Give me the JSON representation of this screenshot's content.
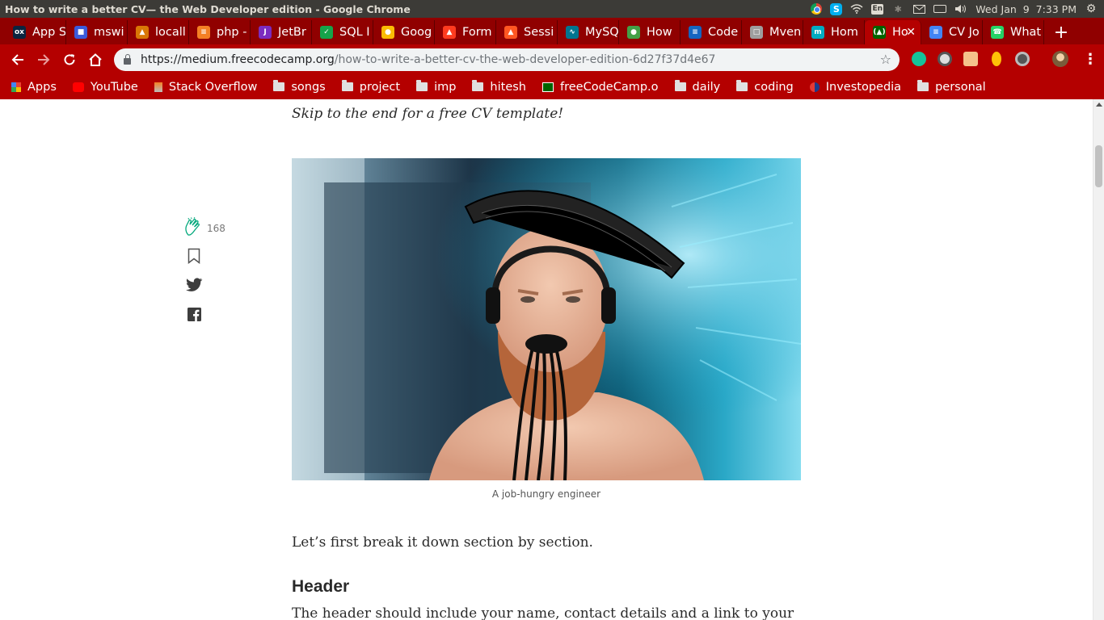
{
  "os": {
    "window_title": "How to write a better CV— the Web Developer edition - Google Chrome",
    "keyboard_layout": "En",
    "clock": "Wed Jan  9  7:33 PM"
  },
  "tabs": [
    {
      "label": "App S",
      "color": "#0a2540",
      "glyph": "ox"
    },
    {
      "label": "mswi",
      "color": "#3b5bdb",
      "glyph": "■"
    },
    {
      "label": "locall",
      "color": "#d97706",
      "glyph": "▲"
    },
    {
      "label": "php -",
      "color": "#f48024",
      "glyph": "≡"
    },
    {
      "label": "JetBr",
      "color": "#7b2cbf",
      "glyph": "J"
    },
    {
      "label": "SQL I",
      "color": "#16a34a",
      "glyph": "✓"
    },
    {
      "label": "Goog",
      "color": "#fbbc04",
      "glyph": "●"
    },
    {
      "label": "Form",
      "color": "#ff3b1f",
      "glyph": "▲"
    },
    {
      "label": "Sessi",
      "color": "#ff5722",
      "glyph": "▲"
    },
    {
      "label": "MySQ",
      "color": "#00758f",
      "glyph": "∿"
    },
    {
      "label": "How",
      "color": "#43a047",
      "glyph": "●"
    },
    {
      "label": "Code",
      "color": "#1565c0",
      "glyph": "≡"
    },
    {
      "label": "Mven",
      "color": "#9e9e9e",
      "glyph": "□"
    },
    {
      "label": "Hom",
      "color": "#00acc1",
      "glyph": "m"
    },
    {
      "label": "Ho",
      "color": "#006400",
      "glyph": "(▲)",
      "active": true
    },
    {
      "label": "CV Jo",
      "color": "#4285f4",
      "glyph": "≡"
    },
    {
      "label": "What",
      "color": "#25d366",
      "glyph": "☎"
    }
  ],
  "toolbar": {
    "url_host": "https://medium.freecodecamp.org",
    "url_path": "/how-to-write-a-better-cv-the-web-developer-edition-6d27f37d4e67",
    "extensions": [
      "grammarly-icon",
      "blocker-icon",
      "extension-icon",
      "bulb-icon",
      "circle-icon"
    ]
  },
  "bookmarks": [
    {
      "label": "Apps",
      "type": "apps"
    },
    {
      "label": "YouTube",
      "type": "youtube"
    },
    {
      "label": "Stack Overflow",
      "type": "stackoverflow"
    },
    {
      "label": "songs",
      "type": "folder"
    },
    {
      "label": "project",
      "type": "folder"
    },
    {
      "label": "imp",
      "type": "folder"
    },
    {
      "label": "hitesh",
      "type": "folder"
    },
    {
      "label": "freeCodeCamp.o",
      "type": "freecodecamp"
    },
    {
      "label": "daily",
      "type": "folder"
    },
    {
      "label": "coding",
      "type": "folder"
    },
    {
      "label": "Investopedia",
      "type": "investopedia"
    },
    {
      "label": "personal",
      "type": "folder"
    }
  ],
  "article": {
    "intro_italic": "Skip to the end for a free CV template!",
    "image_caption": "A job-hungry engineer",
    "paragraph_1": "Let’s first break it down section by section.",
    "heading_header": "Header",
    "paragraph_2": "The header should include your name, contact details and a link to your"
  },
  "share": {
    "claps": "168"
  },
  "colors": {
    "tab_strip": "#900000",
    "toolbar": "#b40000",
    "medium_green": "#03a87c"
  }
}
